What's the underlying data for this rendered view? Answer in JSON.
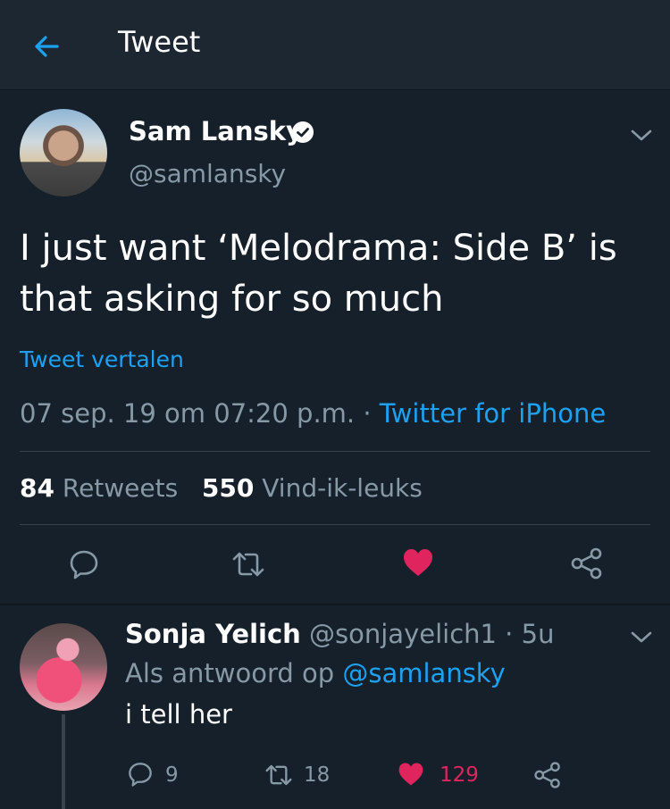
{
  "header": {
    "title": "Tweet",
    "back_icon": "arrow-left-icon"
  },
  "tweet": {
    "author_name": "Sam Lansky",
    "author_handle": "@samlansky",
    "verified": true,
    "text": "I just want ‘Melodrama: Side B’ is that asking for so much",
    "translate_label": "Tweet vertalen",
    "timestamp": "07 sep. 19 om 07:20 p.m.",
    "meta_separator": " · ",
    "source": "Twitter for iPhone",
    "retweets_count": "84",
    "retweets_label": "Retweets",
    "likes_count": "550",
    "likes_label": "Vind-ik-leuks",
    "actions": [
      "reply-icon",
      "retweet-icon",
      "heart-icon",
      "share-icon"
    ],
    "liked": true
  },
  "reply": {
    "author_name": "Sonja Yelich",
    "author_handle": "@sonjayelich1",
    "age": "5u",
    "age_separator": " · ",
    "replying_to_prefix": "Als antwoord op",
    "replying_to_handle": "@samlansky",
    "text": "i tell her",
    "reply_count": "9",
    "retweet_count": "18",
    "like_count": "129",
    "liked": true
  },
  "colors": {
    "background": "#15202b",
    "header": "#1c2732",
    "accent": "#1da1f2",
    "muted": "#8899a6",
    "like": "#e0245e",
    "divider": "#38444d"
  }
}
